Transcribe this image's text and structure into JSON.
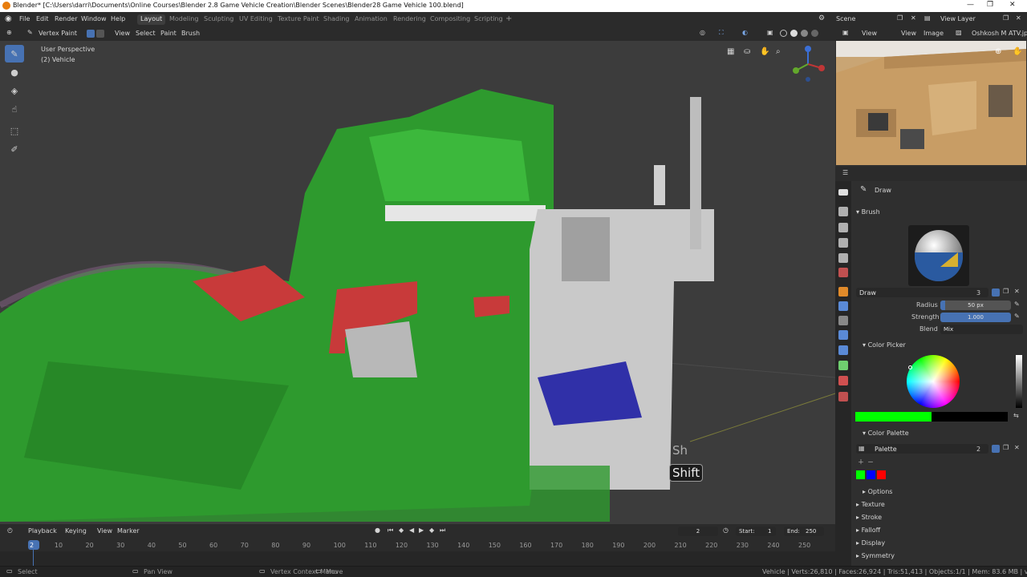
{
  "titlebar": {
    "title": "Blender* [C:\\Users\\darri\\Documents\\Online Courses\\Blender 2.8 Game Vehicle Creation\\Blender Scenes\\Blender28 Game Vehicle 100.blend]"
  },
  "menu": [
    "File",
    "Edit",
    "Render",
    "Window",
    "Help"
  ],
  "workspaces": [
    "Layout",
    "Modeling",
    "Sculpting",
    "UV Editing",
    "Texture Paint",
    "Shading",
    "Animation",
    "Rendering",
    "Compositing",
    "Scripting"
  ],
  "active_workspace": "Layout",
  "scene": "Scene",
  "view_layer": "View Layer",
  "viewport": {
    "mode": "Vertex Paint",
    "menus": [
      "View",
      "Select",
      "Paint",
      "Brush"
    ],
    "perspective": "User Perspective",
    "object": "(2) Vehicle",
    "key_hint": "Shift",
    "key_hint_ghost": "Sh"
  },
  "image_editor": {
    "menus": [
      "View",
      "View",
      "Image"
    ],
    "image_name": "Oshkosh M ATV.jpg"
  },
  "properties": {
    "tool_name": "Draw",
    "brush_section": "Brush",
    "brush_name": "Draw",
    "brush_users": "3",
    "radius_label": "Radius",
    "radius_value": "50 px",
    "strength_label": "Strength",
    "strength_value": "1.000",
    "blend_label": "Blend",
    "blend_value": "Mix",
    "color_picker": "Color Picker",
    "color_palette": "Color Palette",
    "palette_name": "Palette",
    "palette_users": "2",
    "options": "Options",
    "sections": [
      "Texture",
      "Stroke",
      "Falloff",
      "Display",
      "Symmetry"
    ],
    "active_color": "#00ff00",
    "palette_colors": [
      "#00ff00",
      "#0000ff",
      "#ff0000"
    ]
  },
  "timeline": {
    "menus": [
      "Playback",
      "Keying",
      "View",
      "Marker"
    ],
    "current_frame": "2",
    "start_label": "Start:",
    "start": "1",
    "end_label": "End:",
    "end": "250",
    "ticks": [
      "2",
      "10",
      "20",
      "30",
      "40",
      "50",
      "60",
      "70",
      "80",
      "90",
      "100",
      "110",
      "120",
      "130",
      "140",
      "150",
      "160",
      "170",
      "180",
      "190",
      "200",
      "210",
      "220",
      "230",
      "240",
      "250"
    ]
  },
  "status": {
    "select": "Select",
    "pan": "Pan View",
    "context": "Vertex Context Menu",
    "move": "Move",
    "stats": "Vehicle | Verts:26,810 | Faces:26,924 | Tris:51,413 | Objects:1/1 | Mem: 83.6 MB | v2.80.75"
  }
}
